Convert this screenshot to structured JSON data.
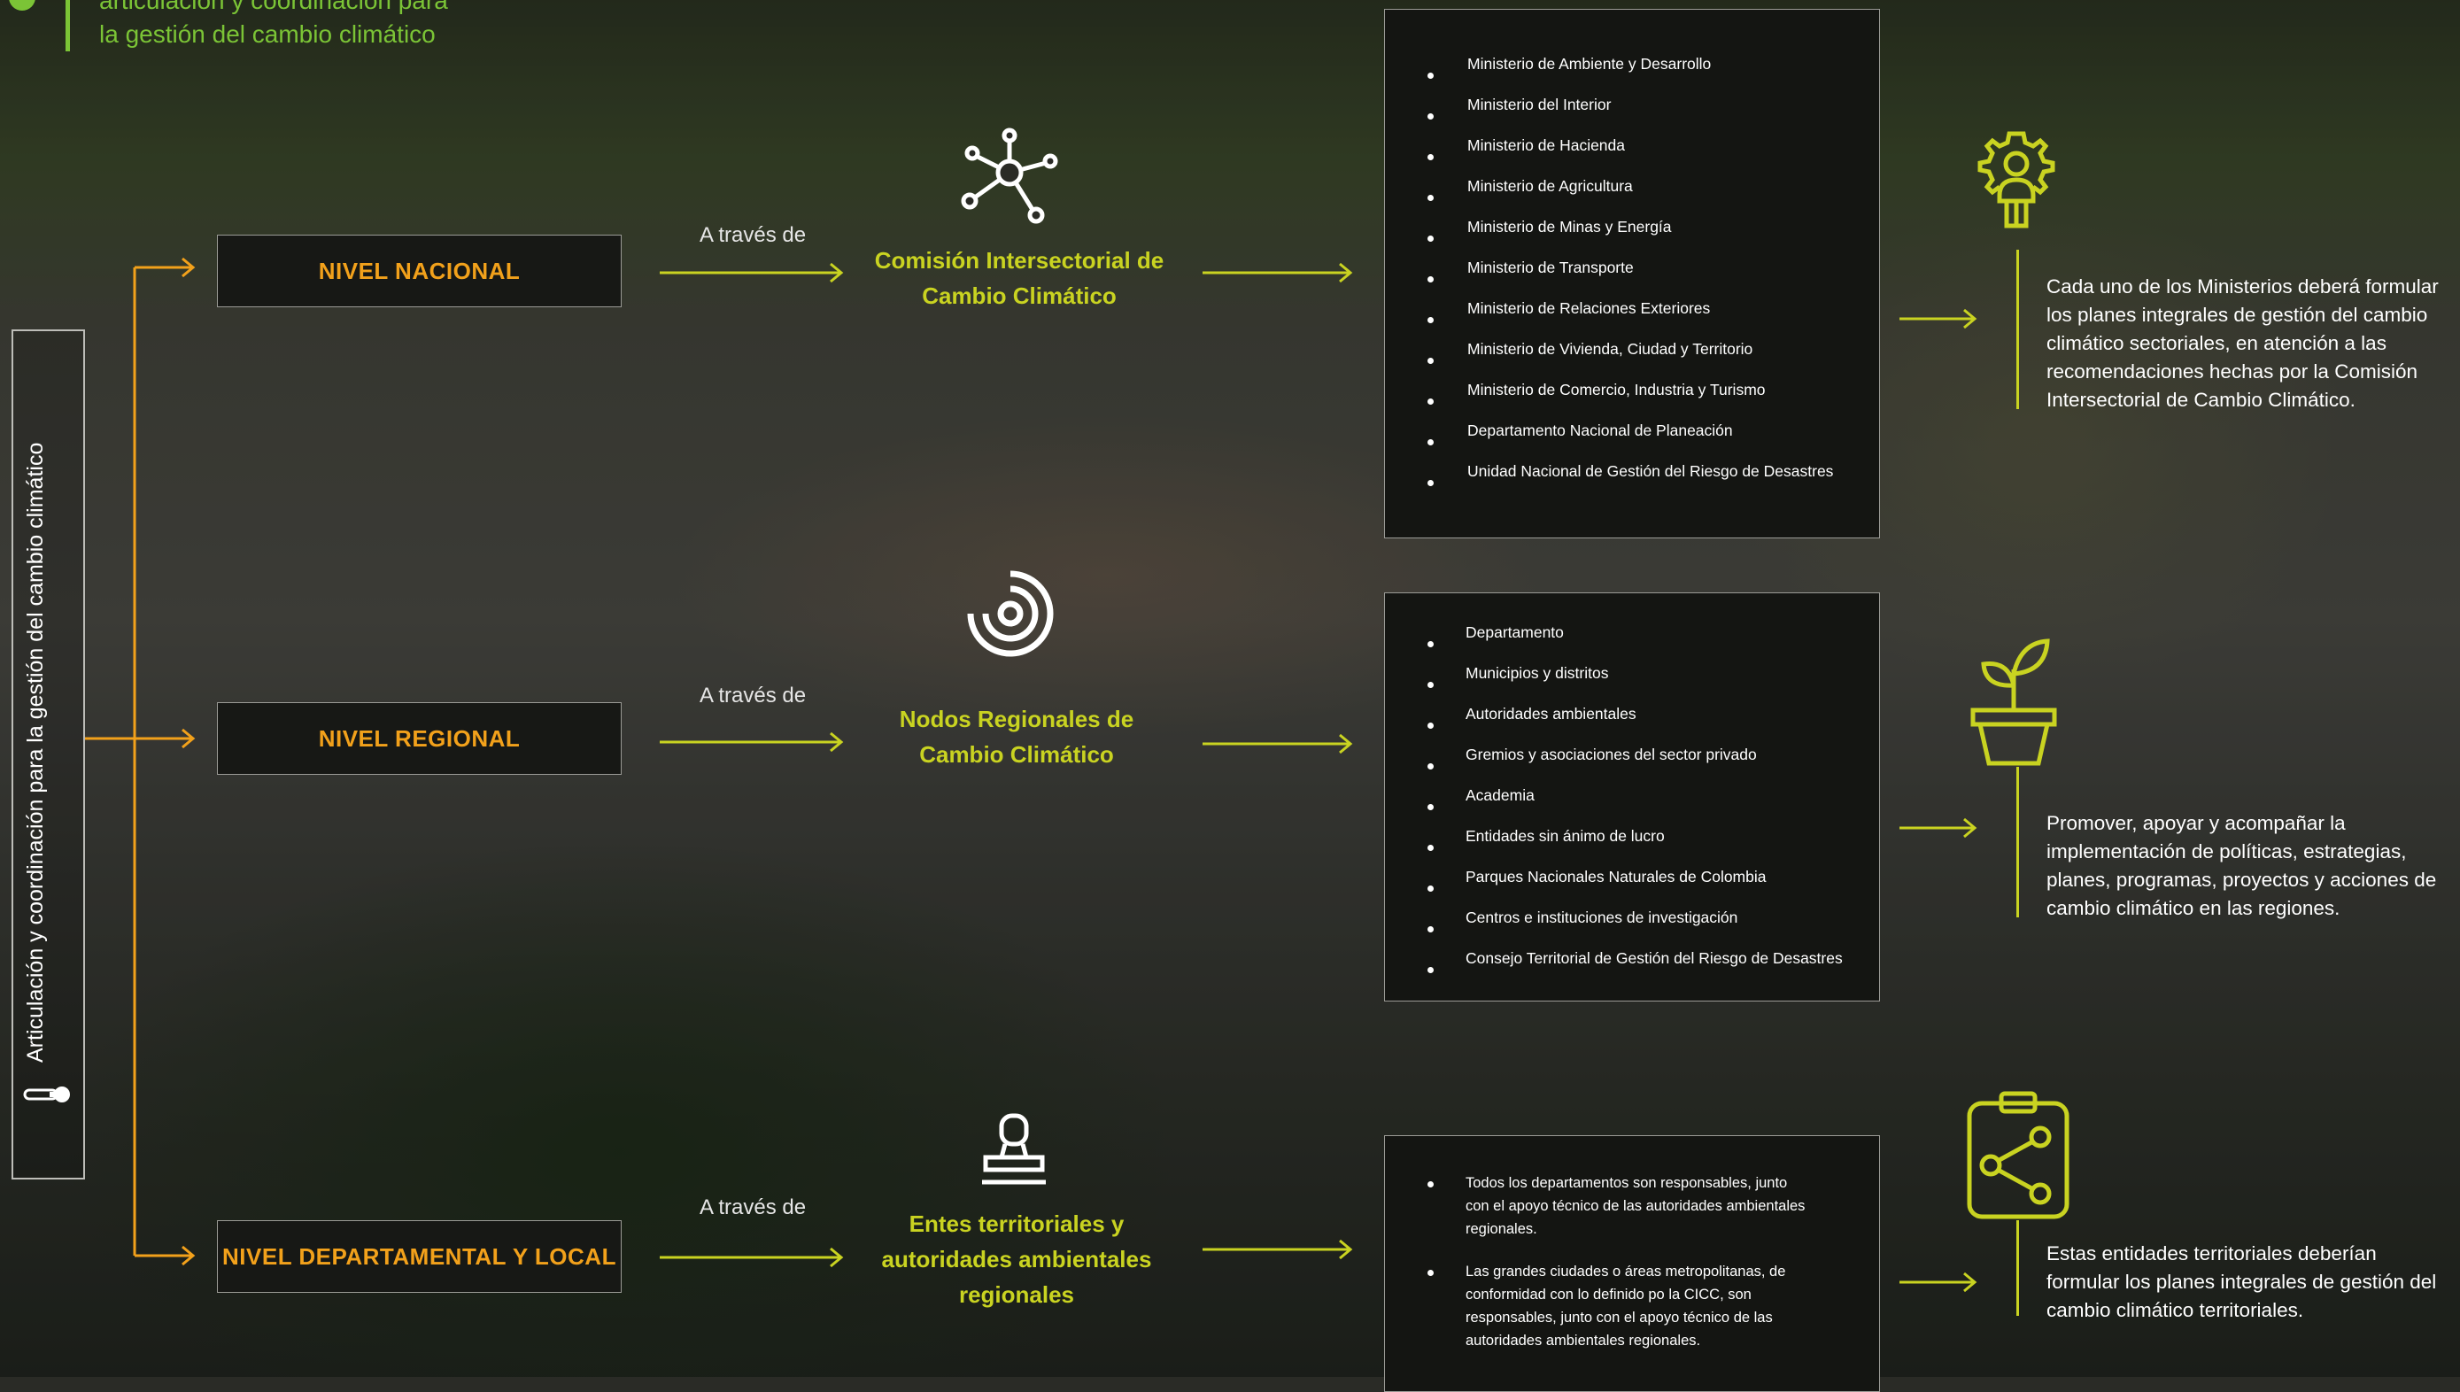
{
  "header": {
    "line1": "articulación y coordinación para",
    "line2": "la gestión del cambio climático"
  },
  "side_label": "Articulación y coordinación para la gestión del cambio climático",
  "connector": "A través de",
  "colors": {
    "accent": "#c9d321",
    "level_text": "#f2a11b",
    "header_green": "#7bc436"
  },
  "rows": [
    {
      "level": "NIVEL NACIONAL",
      "icon": "network-nodes-icon",
      "entity": [
        "Comisión Intersectorial de",
        "Cambio Climático"
      ],
      "items": [
        "Ministerio de Ambiente y Desarrollo",
        "Ministerio del Interior",
        "Ministerio de Hacienda",
        "Ministerio de Agricultura",
        "Ministerio de Minas y Energía",
        "Ministerio de Transporte",
        "Ministerio de Relaciones Exteriores",
        "Ministerio de Vivienda, Ciudad y Territorio",
        "Ministerio de Comercio, Industria y Turismo",
        "Departamento Nacional de Planeación",
        "Unidad Nacional de Gestión del Riesgo de Desastres"
      ],
      "result_icon": "gear-person-icon",
      "result_text": "Cada uno de los Ministerios deberá formular los planes integrales de gestión del cambio climático sectoriales, en atención a las recomendaciones hechas por la Comisión Intersectorial de Cambio Climático."
    },
    {
      "level": "NIVEL REGIONAL",
      "icon": "concentric-circles-icon",
      "entity": [
        "Nodos Regionales de",
        "Cambio Climático"
      ],
      "items": [
        "Departamento",
        "Municipios y distritos",
        "Autoridades ambientales",
        "Gremios y asociaciones del sector privado",
        "Academia",
        "Entidades sin ánimo de lucro",
        "Parques Nacionales Naturales de Colombia",
        "Centros e instituciones de investigación",
        "Consejo Territorial de Gestión del Riesgo de Desastres"
      ],
      "result_icon": "potted-plant-icon",
      "result_text": "Promover, apoyar y acompañar la implementación de políticas, estrategias, planes, programas, proyectos y acciones de cambio climático en las regiones."
    },
    {
      "level": "NIVEL DEPARTAMENTAL Y LOCAL",
      "icon": "stamp-icon",
      "entity": [
        "Entes territoriales y",
        "autoridades ambientales",
        "regionales"
      ],
      "items": [
        "Todos los departamentos son responsables, junto con el apoyo técnico de las autoridades ambientales regionales.",
        "Las grandes ciudades o áreas metropolitanas, de conformidad con lo definido po la CICC, son responsables, junto con el apoyo técnico de las autoridades ambientales regionales."
      ],
      "result_icon": "clipboard-share-icon",
      "result_text": "Estas entidades territoriales deberían formular los planes integrales de gestión del cambio climático territoriales."
    }
  ]
}
